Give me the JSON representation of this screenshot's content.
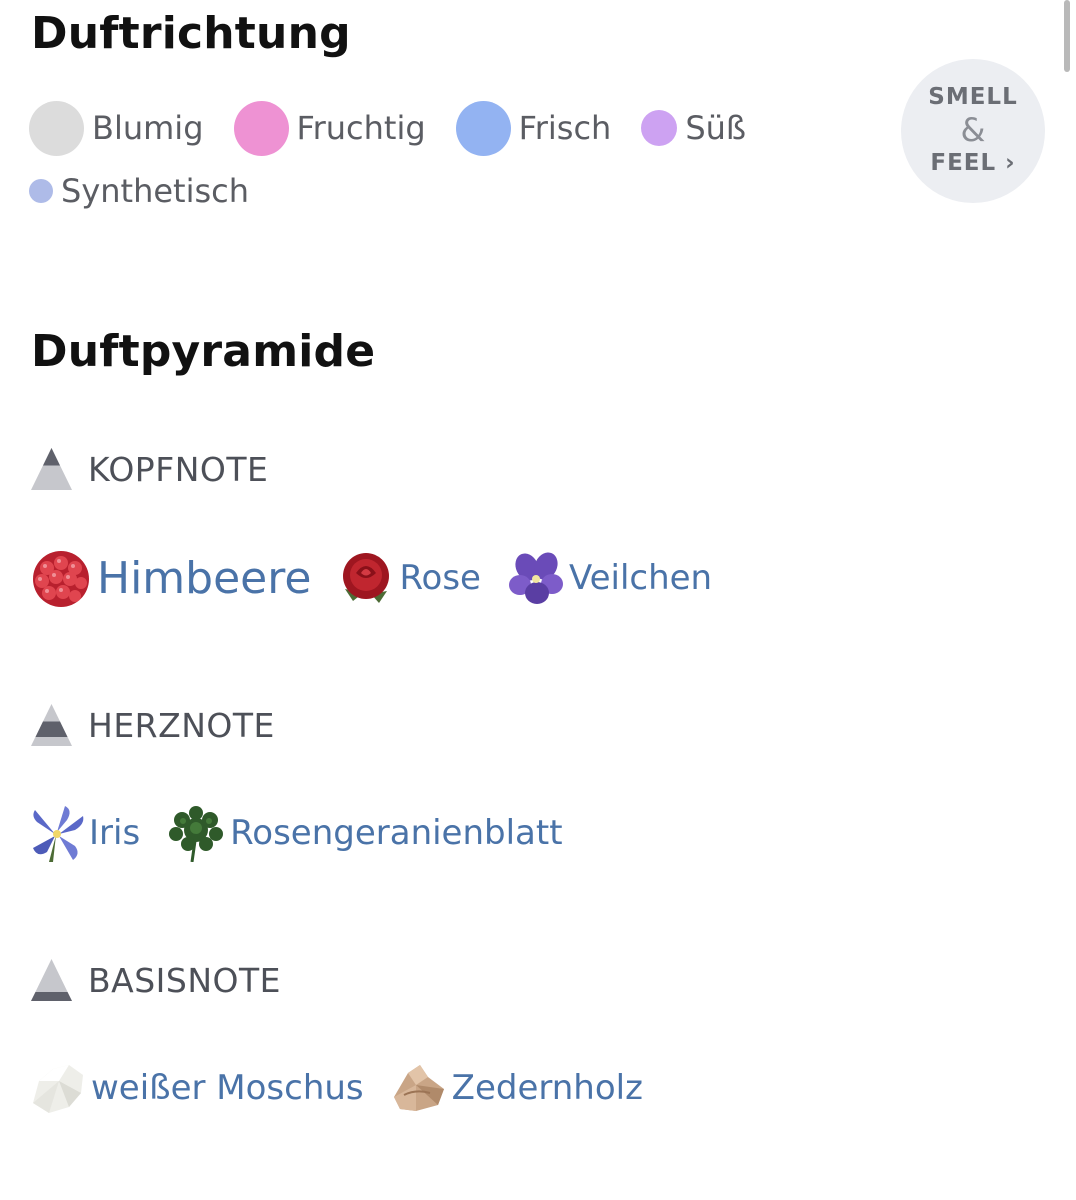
{
  "duftrichtung": {
    "title": "Duftrichtung",
    "accords": [
      {
        "label": "Blumig",
        "color": "#dcdcdc",
        "size": "large"
      },
      {
        "label": "Fruchtig",
        "color": "#ee92d3",
        "size": "large"
      },
      {
        "label": "Frisch",
        "color": "#93b3f2",
        "size": "large"
      },
      {
        "label": "Süß",
        "color": "#cda2f2",
        "size": "medium"
      },
      {
        "label": "Synthetisch",
        "color": "#aebbe8",
        "size": "small"
      }
    ],
    "smell_feel": {
      "line1": "SMELL",
      "line2": "&",
      "line3": "FEEL ›"
    }
  },
  "duftpyramide": {
    "title": "Duftpyramide",
    "kopfnote": {
      "label": "KOPFNOTE",
      "notes": [
        {
          "label": "Himbeere",
          "icon": "raspberry-icon"
        },
        {
          "label": "Rose",
          "icon": "rose-icon"
        },
        {
          "label": "Veilchen",
          "icon": "violet-flower-icon"
        }
      ]
    },
    "herznote": {
      "label": "HERZNOTE",
      "notes": [
        {
          "label": "Iris",
          "icon": "iris-flower-icon"
        },
        {
          "label": "Rosengeranienblatt",
          "icon": "geranium-leaf-icon"
        }
      ]
    },
    "basisnote": {
      "label": "BASISNOTE",
      "notes": [
        {
          "label": "weißer Moschus",
          "icon": "white-musk-icon"
        },
        {
          "label": "Zedernholz",
          "icon": "cedarwood-icon"
        }
      ]
    }
  },
  "colors": {
    "note_link": "#4a73a8",
    "heading": "#111111",
    "pyramid_dark": "#5f616b",
    "pyramid_light": "#c6c7cc"
  }
}
